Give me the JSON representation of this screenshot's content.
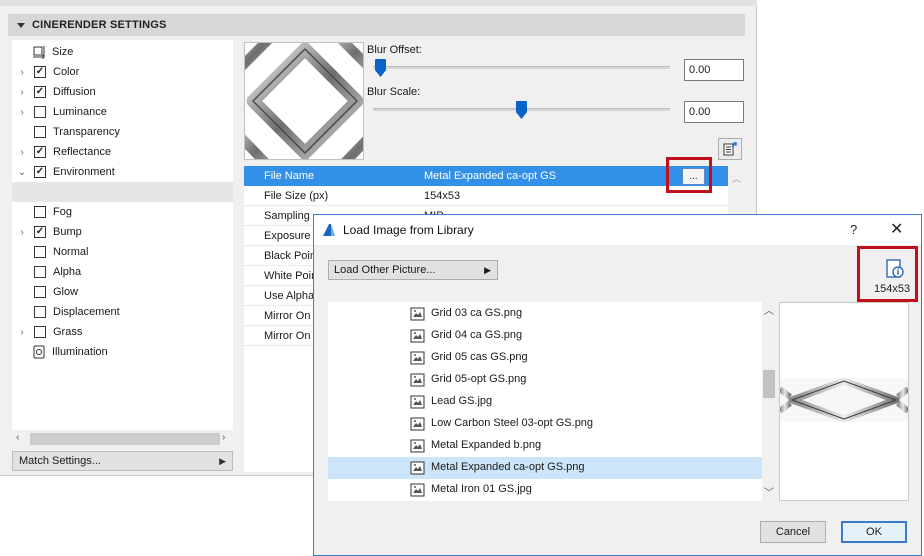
{
  "panel": {
    "section_title": "CINERENDER SETTINGS",
    "channels": [
      {
        "label": "Size",
        "arrow": "",
        "check": "none",
        "icon": "size-icon"
      },
      {
        "label": "Color",
        "arrow": "›",
        "check": "checked",
        "icon": ""
      },
      {
        "label": "Diffusion",
        "arrow": "›",
        "check": "checked",
        "icon": ""
      },
      {
        "label": "Luminance",
        "arrow": "›",
        "check": "unchecked",
        "icon": ""
      },
      {
        "label": "Transparency",
        "arrow": "",
        "check": "unchecked",
        "icon": ""
      },
      {
        "label": "Reflectance",
        "arrow": "›",
        "check": "checked",
        "icon": ""
      },
      {
        "label": "Environment",
        "arrow": "⌄",
        "check": "checked",
        "icon": ""
      },
      {
        "label": "",
        "arrow": "",
        "check": "none",
        "icon": ""
      },
      {
        "label": "Fog",
        "arrow": "",
        "check": "unchecked",
        "icon": ""
      },
      {
        "label": "Bump",
        "arrow": "›",
        "check": "checked",
        "icon": ""
      },
      {
        "label": "Normal",
        "arrow": "",
        "check": "unchecked",
        "icon": ""
      },
      {
        "label": "Alpha",
        "arrow": "",
        "check": "unchecked",
        "icon": ""
      },
      {
        "label": "Glow",
        "arrow": "",
        "check": "unchecked",
        "icon": ""
      },
      {
        "label": "Displacement",
        "arrow": "",
        "check": "unchecked",
        "icon": ""
      },
      {
        "label": "Grass",
        "arrow": "›",
        "check": "unchecked",
        "icon": ""
      },
      {
        "label": "Illumination",
        "arrow": "",
        "check": "none",
        "icon": "illumination-icon"
      }
    ],
    "match_settings_label": "Match Settings...",
    "blur_offset": {
      "label": "Blur Offset:",
      "value": "0.00",
      "level": 0.0
    },
    "blur_scale": {
      "label": "Blur Scale:",
      "value": "0.00",
      "level": 0.5
    },
    "properties": [
      {
        "key": "File Name",
        "value": "Metal Expanded ca-opt GS",
        "selected": true
      },
      {
        "key": "File Size (px)",
        "value": "154x53",
        "selected": false
      },
      {
        "key": "Sampling",
        "value": "MIP",
        "selected": false
      },
      {
        "key": "Exposure",
        "value": "",
        "selected": false
      },
      {
        "key": "Black Point",
        "value": "",
        "selected": false
      },
      {
        "key": "White Point",
        "value": "",
        "selected": false
      },
      {
        "key": "Use Alpha",
        "value": "",
        "selected": false
      },
      {
        "key": "Mirror On X",
        "value": "",
        "selected": false
      },
      {
        "key": "Mirror On Y",
        "value": "",
        "selected": false
      }
    ],
    "browse_label": "..."
  },
  "dialog": {
    "title": "Load Image from Library",
    "help_label": "?",
    "close_label": "✕",
    "load_other_label": "Load Other Picture...",
    "image_size": "154x53",
    "files": [
      {
        "name": "Grid 03 ca GS.png",
        "selected": false
      },
      {
        "name": "Grid 04 ca GS.png",
        "selected": false
      },
      {
        "name": "Grid 05 cas GS.png",
        "selected": false
      },
      {
        "name": "Grid 05-opt GS.png",
        "selected": false
      },
      {
        "name": "Lead GS.jpg",
        "selected": false
      },
      {
        "name": "Low Carbon Steel 03-opt GS.png",
        "selected": false
      },
      {
        "name": "Metal Expanded b.png",
        "selected": false
      },
      {
        "name": "Metal Expanded ca-opt GS.png",
        "selected": true
      },
      {
        "name": "Metal Iron 01 GS.jpg",
        "selected": false
      }
    ],
    "cancel_label": "Cancel",
    "ok_label": "OK"
  },
  "colors": {
    "selection_blue": "#3390e8",
    "list_selection": "#cde5fb",
    "highlight_red": "#c0101e",
    "slider_blue": "#0a64c8",
    "dialog_border": "#3a7cc8"
  }
}
